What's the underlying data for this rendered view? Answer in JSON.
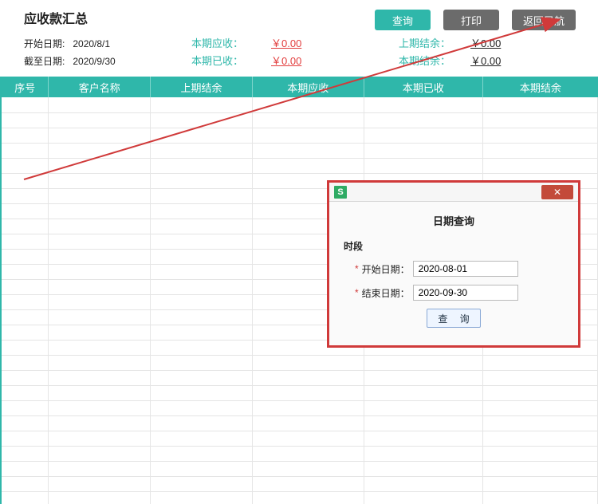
{
  "header": {
    "title": "应收款汇总",
    "buttons": {
      "query": "查询",
      "print": "打印",
      "back": "返回导航"
    }
  },
  "dates": {
    "start_label": "开始日期:",
    "start_value": "2020/8/1",
    "end_label": "截至日期:",
    "end_value": "2020/9/30"
  },
  "summary": {
    "receivable_label": "本期应收：",
    "receivable_value": "￥0.00",
    "received_label": "本期已收：",
    "received_value": "￥0.00",
    "prev_balance_label": "上期结余：",
    "prev_balance_value": "￥0.00",
    "curr_balance_label": "本期结余：",
    "curr_balance_value": "￥0.00"
  },
  "table": {
    "columns": [
      "序号",
      "客户名称",
      "上期结余",
      "本期应收",
      "本期已收",
      "本期结余"
    ],
    "row_count": 27
  },
  "dialog": {
    "icon_letter": "S",
    "close_glyph": "✕",
    "title": "日期查询",
    "section": "时段",
    "start_label": "开始日期：",
    "start_value": "2020-08-01",
    "end_label": "结束日期：",
    "end_value": "2020-09-30",
    "query_label": "查 询"
  }
}
